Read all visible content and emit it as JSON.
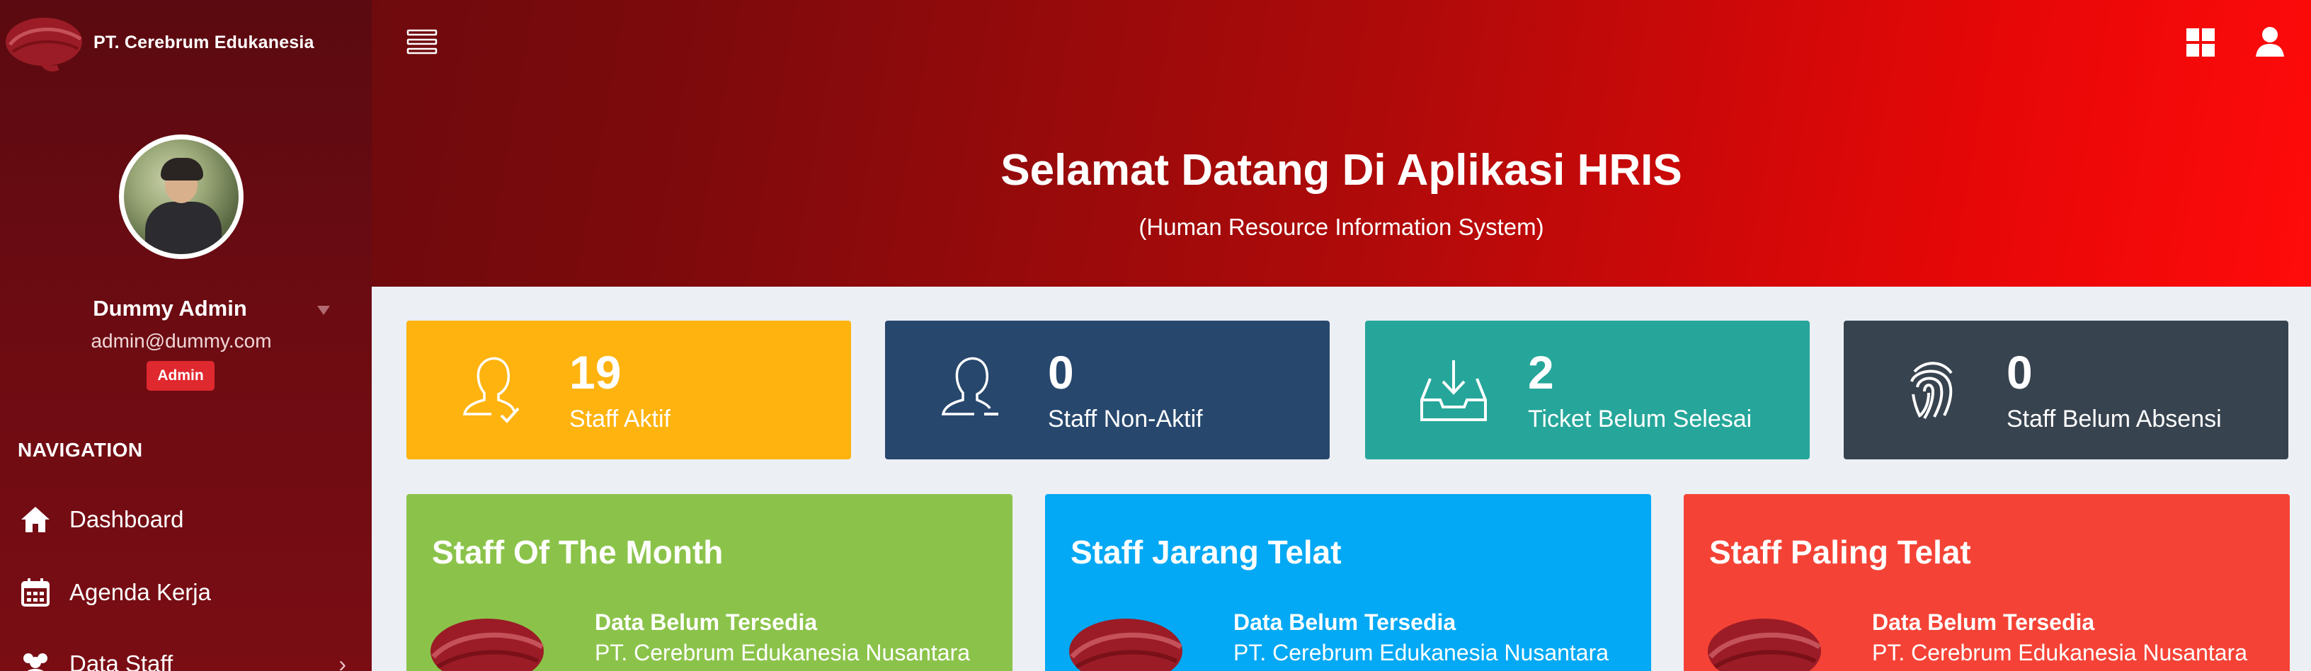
{
  "app": {
    "brand_name": "PT. Cerebrum Edukanesia",
    "hero_title": "Selamat Datang Di Aplikasi HRIS",
    "hero_subtitle": "(Human Resource Information System)"
  },
  "user": {
    "name": "Dummy Admin",
    "email": "admin@dummy.com",
    "role": "Admin"
  },
  "nav": {
    "header": "NAVIGATION",
    "items": [
      {
        "label": "Dashboard",
        "icon": "home-icon"
      },
      {
        "label": "Agenda Kerja",
        "icon": "calendar-icon"
      },
      {
        "label": "Data Staff",
        "icon": "users-icon",
        "chevron": "›"
      }
    ]
  },
  "stats": [
    {
      "value": "19",
      "label": "Staff Aktif",
      "color": "#ffb30f",
      "icon": "user-check-icon"
    },
    {
      "value": "0",
      "label": "Staff Non-Aktif",
      "color": "#27476d",
      "icon": "user-minus-icon"
    },
    {
      "value": "2",
      "label": "Ticket Belum Selesai",
      "color": "#26a69a",
      "icon": "inbox-download-icon"
    },
    {
      "value": "0",
      "label": "Staff Belum Absensi",
      "color": "#37434f",
      "icon": "fingerprint-icon"
    }
  ],
  "cards": [
    {
      "title": "Staff Of The Month",
      "name": "Data Belum Tersedia",
      "company": "PT. Cerebrum Edukanesia Nusantara",
      "color": "#8bc34a"
    },
    {
      "title": "Staff Jarang Telat",
      "name": "Data Belum Tersedia",
      "company": "PT. Cerebrum Edukanesia Nusantara",
      "color": "#03a9f4"
    },
    {
      "title": "Staff Paling Telat",
      "name": "Data Belum Tersedia",
      "company": "PT. Cerebrum Edukanesia Nusantara",
      "color": "#f44336"
    }
  ]
}
